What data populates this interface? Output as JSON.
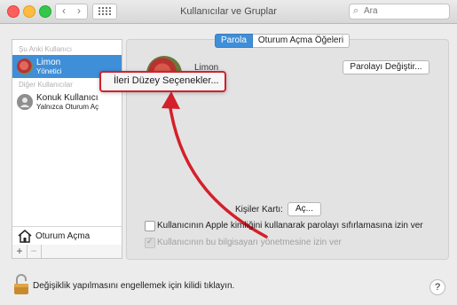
{
  "window": {
    "title": "Kullanıcılar ve Gruplar"
  },
  "toolbar": {
    "back_glyph": "‹",
    "forward_glyph": "›",
    "search_placeholder": "Ara"
  },
  "sidebar": {
    "current_section": "Şu Anki Kullanıcı",
    "current_user": {
      "name": "Limon",
      "role": "Yönetici"
    },
    "other_section": "Diğer Kullanıcılar",
    "other_user": {
      "name": "Konuk Kullanıcı",
      "role": "Yalnızca Oturum Aç"
    },
    "login_options": "Oturum Açma",
    "plus": "+",
    "minus": "−"
  },
  "tabs": [
    {
      "label": "Parola",
      "active": true
    },
    {
      "label": "Oturum Açma Öğeleri",
      "active": false
    }
  ],
  "main": {
    "username": "Limon",
    "change_password": "Parolayı Değiştir...",
    "context_menu": "İleri Düzey Seçenekler...",
    "contacts_card_label": "Kişiler Kartı:",
    "open_button": "Aç...",
    "checkbox_reset": "Kullanıcının Apple kimliğini kullanarak parolayı sıfırlamasına izin ver",
    "checkbox_admin": "Kullanıcının bu bilgisayarı yönetmesine izin ver"
  },
  "footer": {
    "lock_text": "Değişiklik yapılmasını engellemek için kilidi tıklayın.",
    "help": "?"
  },
  "colors": {
    "selection": "#3f8ed8",
    "annotation": "#d4202a"
  }
}
